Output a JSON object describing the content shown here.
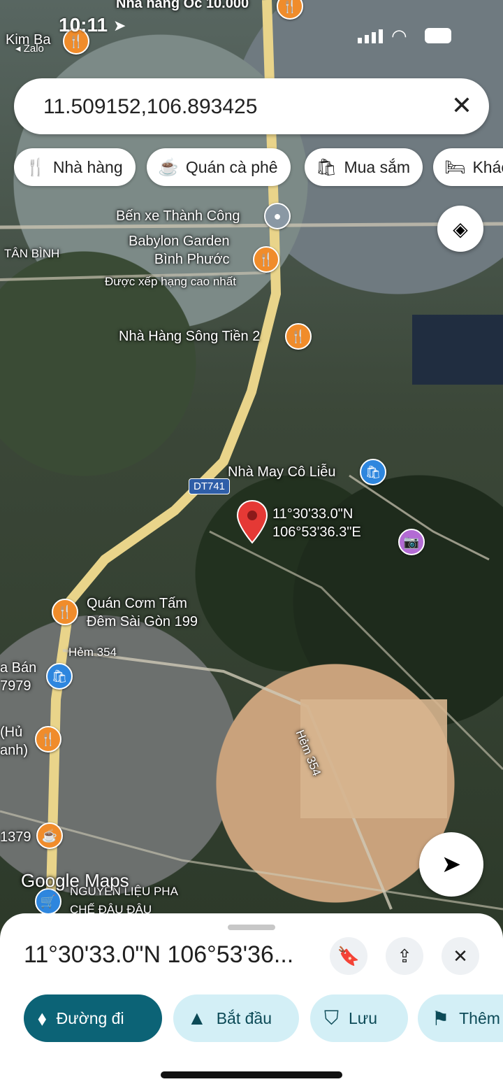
{
  "status_bar": {
    "time": "10:11",
    "back_app": "Zalo"
  },
  "search": {
    "value": "11.509152,106.893425"
  },
  "chips": [
    {
      "label": "Nhà hàng",
      "icon": "restaurant-icon"
    },
    {
      "label": "Quán cà phê",
      "icon": "coffee-icon"
    },
    {
      "label": "Mua sắm",
      "icon": "shopping-bag-icon"
    },
    {
      "label": "Khác",
      "icon": "bed-icon"
    }
  ],
  "map": {
    "labels": {
      "top_restaurant": "Nhà hàng Ốc 10.000",
      "kim_ba": "Kim Ba",
      "ben_xe": "Bến xe Thành Công",
      "babylon": "Babylon Garden\nBình Phước",
      "babylon_sub": "Được xếp hạng cao nhất",
      "tan_binh": "TÂN BÌNH",
      "song_tien": "Nhà Hàng Sông Tiền 2",
      "nha_may": "Nhà May Cô Liễu",
      "road_dt741": "DT741",
      "coords": "11°30'33.0\"N\n106°53'36.3\"E",
      "com_tam": "Quán Cơm Tấm\nĐêm Sài Gòn 199",
      "hem354_a": "Hẻm 354",
      "hem354_b": "Hẻm 354",
      "a_ban": "a Bán\n7979",
      "hu_anh": "(Hủ\nanh)",
      "num_1379": "1379",
      "nguyen_lieu": "NGUYÊN LIỆU PHA\nCHẾ ĐẬU ĐẬU",
      "attribution": "Google Maps"
    }
  },
  "sheet": {
    "title": "11°30'33.0\"N 106°53'36...",
    "actions": [
      {
        "label": "Đường đi",
        "icon": "directions-icon"
      },
      {
        "label": "Bắt đầu",
        "icon": "navigation-arrow-icon"
      },
      {
        "label": "Lưu",
        "icon": "bookmark-icon"
      },
      {
        "label": "Thêm",
        "icon": "flag-icon"
      }
    ]
  },
  "colors": {
    "accent": "#0c6376",
    "secondary": "#d3eff6",
    "pin_red": "#e53935",
    "poi_orange": "#f08c2b",
    "poi_blue": "#2e86de"
  }
}
